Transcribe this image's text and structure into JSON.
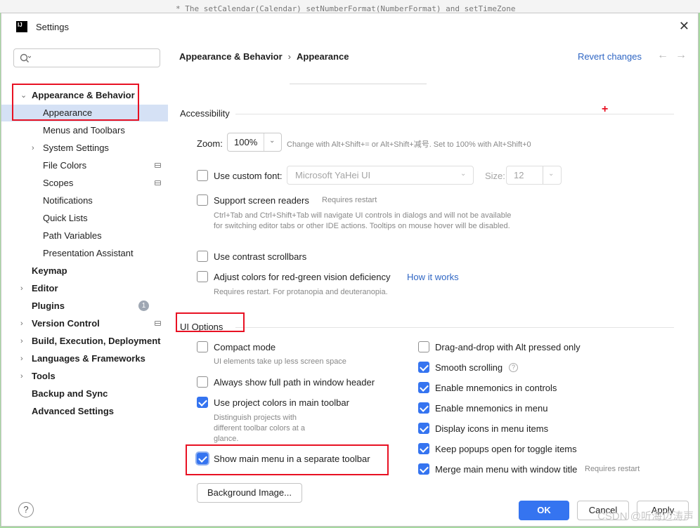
{
  "editor_background": {
    "text": "* The setCalendar(Calendar) setNumberFormat(NumberFormat) and setTimeZone"
  },
  "window": {
    "title": "Settings",
    "logo_text": "IJ"
  },
  "search": {
    "placeholder": "",
    "value": ""
  },
  "sidebar": {
    "items": [
      {
        "label": "Appearance & Behavior",
        "bold": true,
        "expanded": true
      },
      {
        "label": "Appearance",
        "selected": true
      },
      {
        "label": "Menus and Toolbars"
      },
      {
        "label": "System Settings",
        "collapsed": true
      },
      {
        "label": "File Colors"
      },
      {
        "label": "Scopes"
      },
      {
        "label": "Notifications"
      },
      {
        "label": "Quick Lists"
      },
      {
        "label": "Path Variables"
      },
      {
        "label": "Presentation Assistant"
      },
      {
        "label": "Keymap",
        "bold": true
      },
      {
        "label": "Editor",
        "bold": true,
        "collapsed": true
      },
      {
        "label": "Plugins",
        "bold": true,
        "badge": "1"
      },
      {
        "label": "Version Control",
        "bold": true,
        "collapsed": true
      },
      {
        "label": "Build, Execution, Deployment",
        "bold": true,
        "collapsed": true
      },
      {
        "label": "Languages & Frameworks",
        "bold": true,
        "collapsed": true
      },
      {
        "label": "Tools",
        "bold": true,
        "collapsed": true
      },
      {
        "label": "Backup and Sync",
        "bold": true
      },
      {
        "label": "Advanced Settings",
        "bold": true
      }
    ]
  },
  "breadcrumb": {
    "parent": "Appearance & Behavior",
    "separator": "›",
    "current": "Appearance"
  },
  "header": {
    "revert": "Revert changes",
    "back_arrow": "←",
    "forward_arrow": "→"
  },
  "accessibility": {
    "title": "Accessibility",
    "zoom_label": "Zoom:",
    "zoom_value": "100%",
    "zoom_hint": "Change with Alt+Shift+= or Alt+Shift+减号. Set to 100% with Alt+Shift+0",
    "custom_font_label": "Use custom font:",
    "custom_font_checked": false,
    "font_value": "Microsoft YaHei UI",
    "size_label": "Size:",
    "size_value": "12",
    "screen_readers_label": "Support screen readers",
    "screen_readers_checked": false,
    "screen_readers_hint": "Requires restart",
    "screen_readers_desc": "Ctrl+Tab and Ctrl+Shift+Tab will navigate UI controls in dialogs and will not be available for switching editor tabs or other IDE actions. Tooltips on mouse hover will be disabled.",
    "contrast_label": "Use contrast scrollbars",
    "contrast_checked": false,
    "adjust_colors_label": "Adjust colors for red-green vision deficiency",
    "adjust_colors_checked": false,
    "how_it_works": "How it works",
    "adjust_colors_hint": "Requires restart. For protanopia and deuteranopia."
  },
  "ui_options": {
    "title": "UI Options",
    "left": [
      {
        "label": "Compact mode",
        "checked": false,
        "hint": "UI elements take up less screen space"
      },
      {
        "label": "Always show full path in window header",
        "checked": false
      },
      {
        "label": "Use project colors in main toolbar",
        "checked": true,
        "hint": "Distinguish projects with different toolbar colors at a glance."
      },
      {
        "label": "Show main menu in a separate toolbar",
        "checked": true
      }
    ],
    "right": [
      {
        "label": "Drag-and-drop with Alt pressed only",
        "checked": false
      },
      {
        "label": "Smooth scrolling",
        "checked": true,
        "help": "?"
      },
      {
        "label": "Enable mnemonics in controls",
        "checked": true
      },
      {
        "label": "Enable mnemonics in menu",
        "checked": true
      },
      {
        "label": "Display icons in menu items",
        "checked": true
      },
      {
        "label": "Keep popups open for toggle items",
        "checked": true
      },
      {
        "label": "Merge main menu with window title",
        "checked": true,
        "hint": "Requires restart"
      }
    ],
    "background_image_button": "Background Image..."
  },
  "footer": {
    "ok": "OK",
    "cancel": "Cancel",
    "apply": "Apply",
    "help": "?"
  },
  "annotations": {
    "plus": "+"
  },
  "watermark": "CSDN @听海边涛声",
  "colors": {
    "accent": "#3574f0",
    "link": "#2f66c4",
    "selected_row": "#d5e1f5",
    "annotation_red": "#e81123"
  }
}
